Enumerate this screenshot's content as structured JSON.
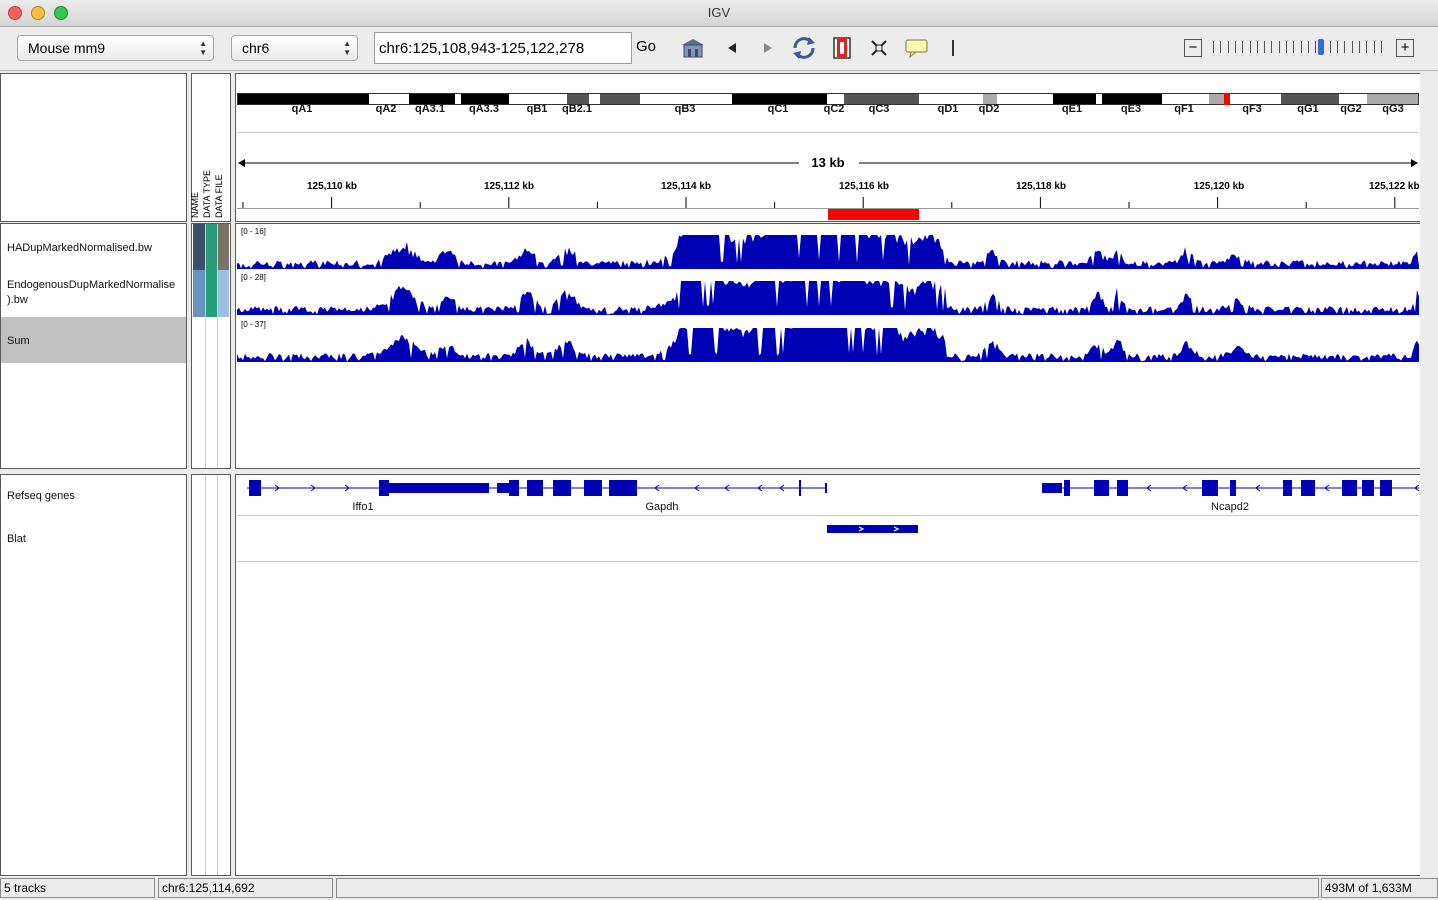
{
  "window": {
    "title": "IGV"
  },
  "toolbar": {
    "genome": "Mouse mm9",
    "chromosome": "chr6",
    "locus": "chr6:125,108,943-125,122,278",
    "go_label": "Go",
    "icons": [
      "home-icon",
      "back-icon",
      "forward-icon",
      "refresh-icon",
      "roi-icon",
      "resize-icon",
      "popup-info-icon",
      "ruler-divider"
    ],
    "zoom_minus": "−",
    "zoom_plus": "+"
  },
  "attribute_headers": [
    "NAME",
    "DATA TYPE",
    "DATA FILE"
  ],
  "cytoband": {
    "labels": [
      "qA1",
      "qA2",
      "qA3.1",
      "qA3.3",
      "qB1",
      "qB2.1",
      "qB3",
      "qC1",
      "qC2",
      "qC3",
      "qD1",
      "qD2",
      "qE1",
      "qE3",
      "qF1",
      "qF3",
      "qG1",
      "qG2",
      "qG3"
    ],
    "span_label": "13 kb",
    "ticks": [
      "125,110 kb",
      "125,112 kb",
      "125,114 kb",
      "125,116 kb",
      "125,118 kb",
      "125,120 kb",
      "125,122 kb"
    ]
  },
  "data_tracks": [
    {
      "name": "HADupMarkedNormalised.bw",
      "range": "[0 - 16]"
    },
    {
      "name": "EndogenousDupMarkedNormalised).bw",
      "name_line1": "EndogenousDupMarkedNormalise",
      "name_line2": ").bw",
      "range": "[0 - 28]"
    },
    {
      "name": "Sum",
      "range": "[0 - 37]"
    }
  ],
  "feature_tracks": [
    {
      "name": "Refseq genes"
    },
    {
      "name": "Blat"
    }
  ],
  "genes": [
    "Iffo1",
    "Gapdh",
    "Ncapd2"
  ],
  "status": {
    "tracks": "5 tracks",
    "position": "chr6:125,114,692",
    "message": "",
    "memory": "493M of 1,633M"
  },
  "colors": {
    "signal": "#0000b4",
    "roi": "#ff0000",
    "selected_track": "#c0c0c0"
  }
}
